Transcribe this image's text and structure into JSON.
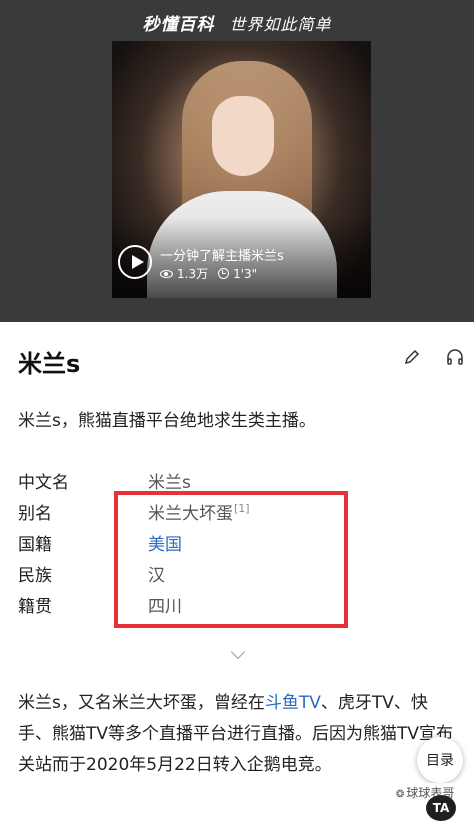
{
  "header": {
    "brand": "秒懂百科",
    "slogan": "世界如此简单"
  },
  "video": {
    "title": "一分钟了解主播米兰s",
    "views": "1.3万",
    "duration": "1'3\""
  },
  "entry": {
    "title": "米兰s",
    "summary": "米兰s，熊猫直播平台绝地求生类主播。"
  },
  "info": {
    "rows": [
      {
        "key": "中文名",
        "value": "米兰s"
      },
      {
        "key": "别名",
        "value": "米兰大坏蛋",
        "ref": "[1]"
      },
      {
        "key": "国籍",
        "value": "美国"
      },
      {
        "key": "民族",
        "value": "汉"
      },
      {
        "key": "籍贯",
        "value": "四川"
      }
    ]
  },
  "body": {
    "part1": "米兰s，又名米兰大坏蛋，曾经在",
    "link1": "斗鱼TV",
    "part2": "、虎牙TV、快手、熊猫TV等多个直播平台进行直播。后因为熊猫TV宣布关站而于2020年5月22日转入企鹅电竞。"
  },
  "floating": {
    "toc_label": "目录",
    "watermark": "球球表哥",
    "badge": "TA"
  },
  "colors": {
    "link": "#2a6bc1",
    "highlight": "#e5323a",
    "hero_bg": "#3a3a3a"
  }
}
